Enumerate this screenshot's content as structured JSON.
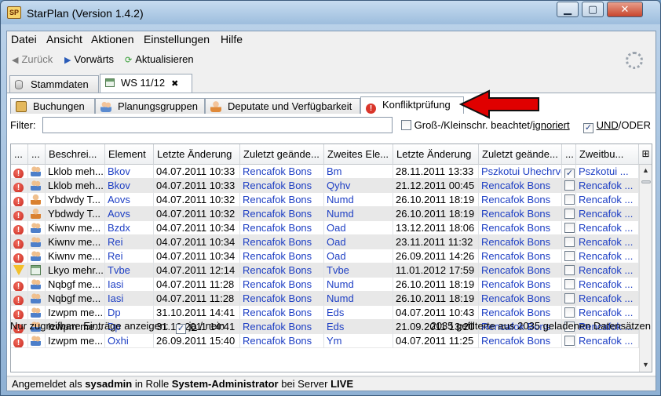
{
  "window": {
    "title": "StarPlan (Version 1.4.2)"
  },
  "menu": [
    "Datei",
    "Ansicht",
    "Aktionen",
    "Einstellungen",
    "Hilfe"
  ],
  "toolbar": {
    "back": "Zurück",
    "forward": "Vorwärts",
    "refresh": "Aktualisieren"
  },
  "outer_tabs": [
    {
      "label": "Stammdaten",
      "icon": "database-icon"
    },
    {
      "label": "WS 11/12",
      "icon": "grid-icon",
      "close": "✖"
    }
  ],
  "inner_tabs": [
    {
      "label": "Buchungen",
      "icon": "book-icon"
    },
    {
      "label": "Planungsgruppen",
      "icon": "group-icon"
    },
    {
      "label": "Deputate und Verfügbarkeit",
      "icon": "user-icon"
    },
    {
      "label": "Konfliktprüfung",
      "icon": "warning-icon"
    }
  ],
  "filter": {
    "label": "Filter:",
    "value": "",
    "case_label_prefix": "Groß-/Kleinschr. beachtet/",
    "case_label_link": "ignoriert",
    "case_checked": false,
    "and_label": "UND",
    "or_label": "/ODER",
    "and_checked": true
  },
  "table": {
    "columns": [
      "...",
      "...",
      "Beschrei...",
      "Element",
      "Letzte Änderung",
      "Zuletzt geände...",
      "Zweites Ele...",
      "Letzte Änderung",
      "Zuletzt geände...",
      "...",
      "Zweitbu..."
    ],
    "rows": [
      {
        "status": "error",
        "type": "group",
        "desc": "Lklob meh...",
        "element": "Bkov",
        "changed": "04.07.2011 10:33",
        "by": "Rencafok Bons",
        "second": "Bm",
        "changed2": "28.11.2011 13:33",
        "by2": "Pszkotui Uhechrvd",
        "checked": true,
        "second_book": "Pszkotui ..."
      },
      {
        "status": "error",
        "type": "group",
        "desc": "Lklob meh...",
        "element": "Bkov",
        "changed": "04.07.2011 10:33",
        "by": "Rencafok Bons",
        "second": "Qyhv",
        "changed2": "21.12.2011 00:45",
        "by2": "Rencafok Bons",
        "checked": false,
        "second_book": "Rencafok ..."
      },
      {
        "status": "error",
        "type": "user",
        "desc": "Ybdwdy T...",
        "element": "Aovs",
        "changed": "04.07.2011 10:32",
        "by": "Rencafok Bons",
        "second": "Numd",
        "changed2": "26.10.2011 18:19",
        "by2": "Rencafok Bons",
        "checked": false,
        "second_book": "Rencafok ..."
      },
      {
        "status": "error",
        "type": "user",
        "desc": "Ybdwdy T...",
        "element": "Aovs",
        "changed": "04.07.2011 10:32",
        "by": "Rencafok Bons",
        "second": "Numd",
        "changed2": "26.10.2011 18:19",
        "by2": "Rencafok Bons",
        "checked": false,
        "second_book": "Rencafok ..."
      },
      {
        "status": "error",
        "type": "group",
        "desc": "Kiwnv me...",
        "element": "Bzdx",
        "changed": "04.07.2011 10:34",
        "by": "Rencafok Bons",
        "second": "Oad",
        "changed2": "13.12.2011 18:06",
        "by2": "Rencafok Bons",
        "checked": false,
        "second_book": "Rencafok ..."
      },
      {
        "status": "error",
        "type": "group",
        "desc": "Kiwnv me...",
        "element": "Rei",
        "changed": "04.07.2011 10:34",
        "by": "Rencafok Bons",
        "second": "Oad",
        "changed2": "23.11.2011 11:32",
        "by2": "Rencafok Bons",
        "checked": false,
        "second_book": "Rencafok ..."
      },
      {
        "status": "error",
        "type": "group",
        "desc": "Kiwnv me...",
        "element": "Rei",
        "changed": "04.07.2011 10:34",
        "by": "Rencafok Bons",
        "second": "Oad",
        "changed2": "26.09.2011 14:26",
        "by2": "Rencafok Bons",
        "checked": false,
        "second_book": "Rencafok ..."
      },
      {
        "status": "warning",
        "type": "room",
        "desc": "Lkyo mehr...",
        "element": "Tvbe",
        "changed": "04.07.2011 12:14",
        "by": "Rencafok Bons",
        "second": "Tvbe",
        "changed2": "11.01.2012 17:59",
        "by2": "Rencafok Bons",
        "checked": false,
        "second_book": "Rencafok ..."
      },
      {
        "status": "error",
        "type": "group",
        "desc": "Nqbgf me...",
        "element": "Iasi",
        "changed": "04.07.2011 11:28",
        "by": "Rencafok Bons",
        "second": "Numd",
        "changed2": "26.10.2011 18:19",
        "by2": "Rencafok Bons",
        "checked": false,
        "second_book": "Rencafok ..."
      },
      {
        "status": "error",
        "type": "group",
        "desc": "Nqbgf me...",
        "element": "Iasi",
        "changed": "04.07.2011 11:28",
        "by": "Rencafok Bons",
        "second": "Numd",
        "changed2": "26.10.2011 18:19",
        "by2": "Rencafok Bons",
        "checked": false,
        "second_book": "Rencafok ..."
      },
      {
        "status": "error",
        "type": "group",
        "desc": "Izwpm me...",
        "element": "Dp",
        "changed": "31.10.2011 14:41",
        "by": "Rencafok Bons",
        "second": "Eds",
        "changed2": "04.07.2011 10:43",
        "by2": "Rencafok Bons",
        "checked": false,
        "second_book": "Rencafok ..."
      },
      {
        "status": "error",
        "type": "group",
        "desc": "Izwpm me...",
        "element": "Dp",
        "changed": "31.10.2011 14:41",
        "by": "Rencafok Bons",
        "second": "Eds",
        "changed2": "21.09.2011 13:20",
        "by2": "Rencafok Bons",
        "checked": false,
        "second_book": "Rencafok ..."
      },
      {
        "status": "error",
        "type": "group",
        "desc": "Izwpm me...",
        "element": "Oxhi",
        "changed": "26.09.2011 15:40",
        "by": "Rencafok Bons",
        "second": "Ym",
        "changed2": "04.07.2011 11:25",
        "by2": "Rencafok Bons",
        "checked": false,
        "second_book": "Rencafok ..."
      }
    ]
  },
  "bottom": {
    "only_accessible_label": "Nur zugreifbare Einträge anzeigen:",
    "yes": "ja",
    "no": "/ nein",
    "count_text": "2035 gefilterte aus 2035 geladenen Datensätzen"
  },
  "status": {
    "prefix": "Angemeldet als ",
    "user": "sysadmin",
    "mid": " in Rolle ",
    "role": "System-Administrator",
    "mid2": " bei Server ",
    "server": "LIVE"
  },
  "colors": {
    "link": "#1e3fc4",
    "annotation_arrow": "#e00000",
    "error": "#d9362b"
  }
}
